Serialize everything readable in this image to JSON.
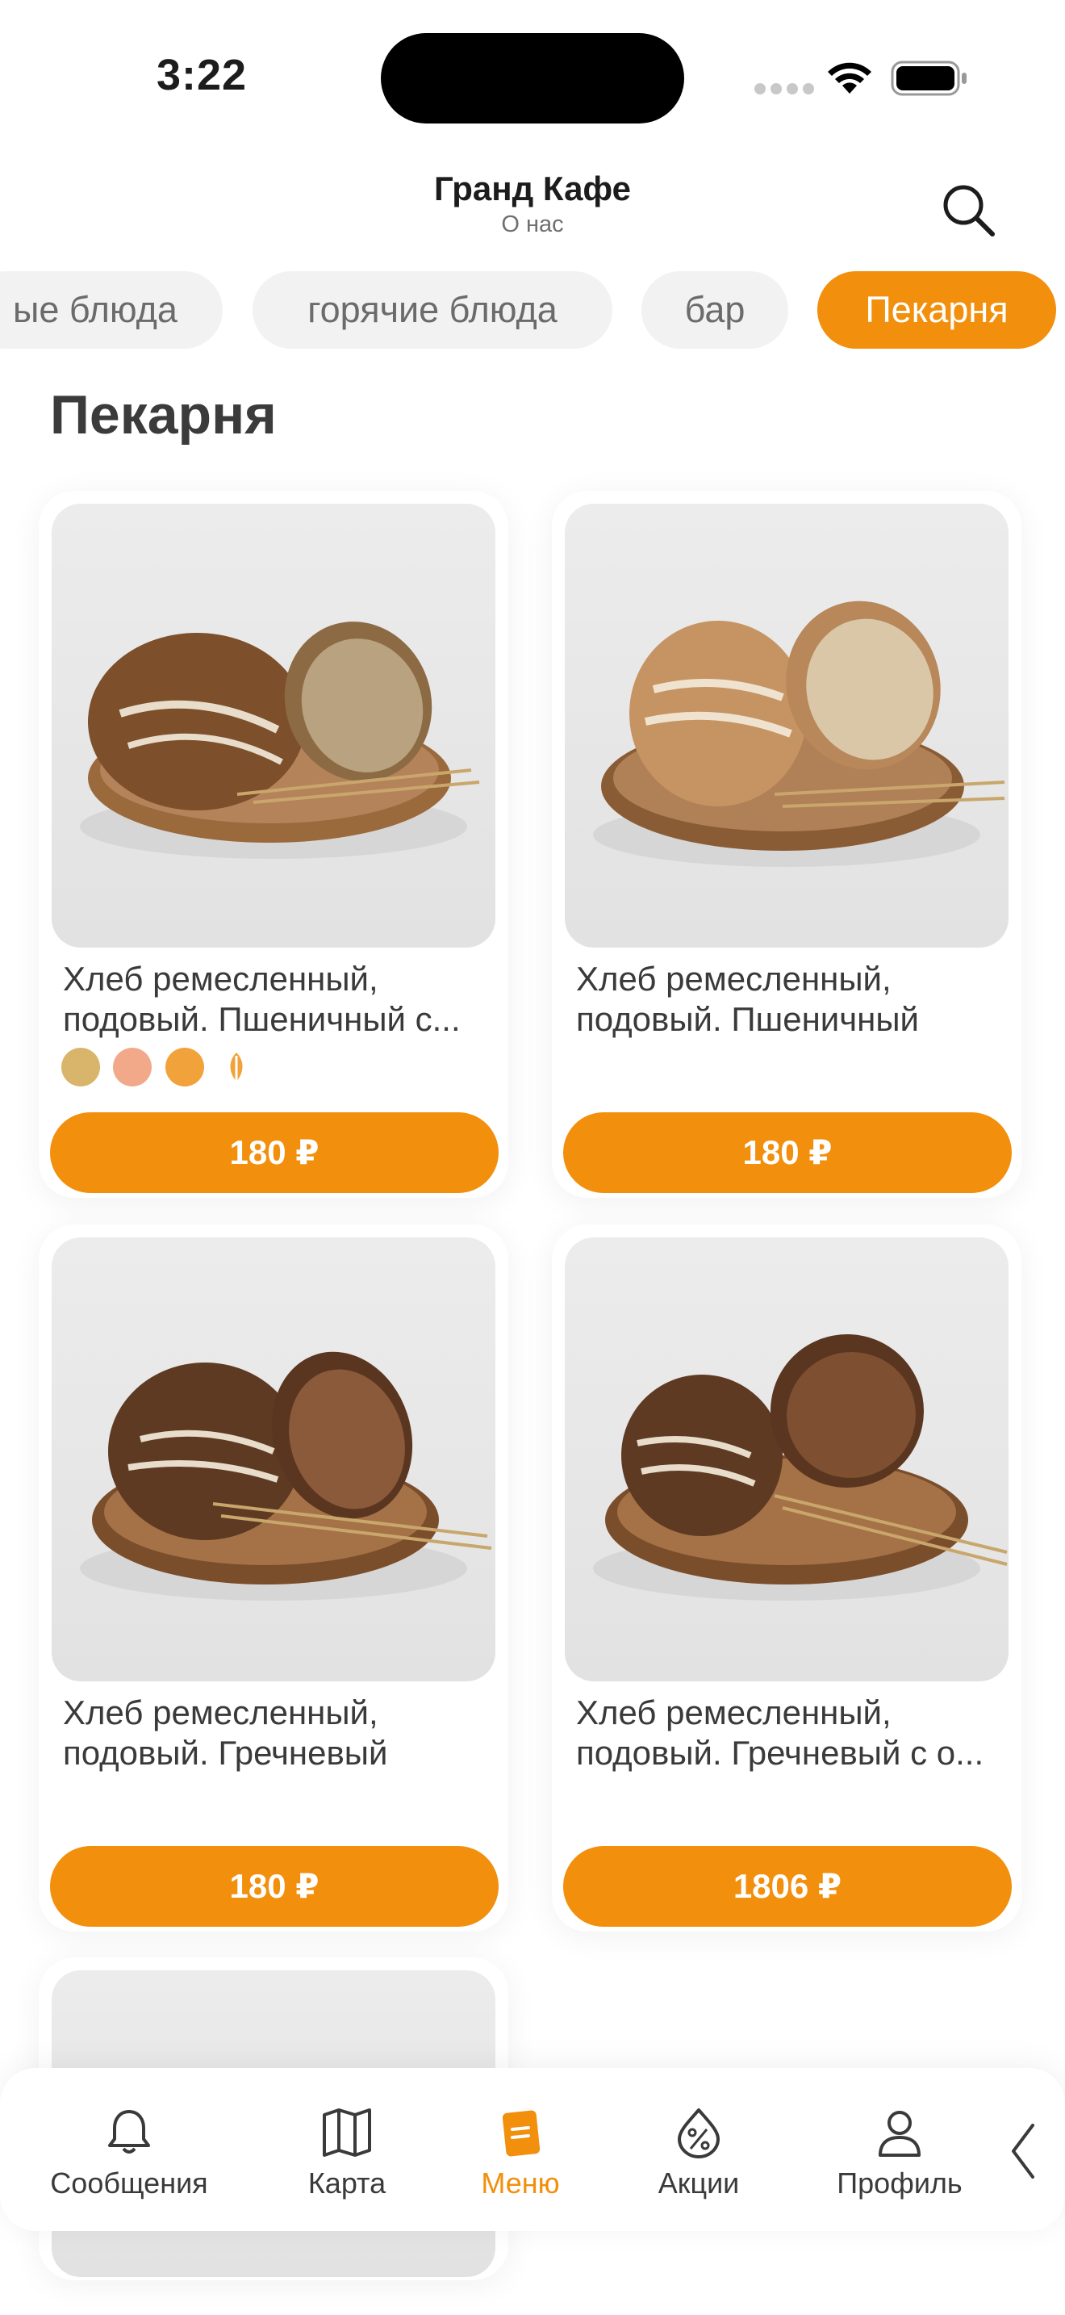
{
  "status": {
    "time": "3:22"
  },
  "header": {
    "title": "Гранд Кафе",
    "subtitle": "О нас",
    "search_icon": "search-icon"
  },
  "tabs": [
    {
      "label": "ые блюда"
    },
    {
      "label": "горячие блюда"
    },
    {
      "label": "бар"
    },
    {
      "label": "Пекарня",
      "active": true
    }
  ],
  "section": {
    "title": "Пекарня"
  },
  "products": [
    {
      "name": "Хлеб ремесленный, подовый. Пшеничный с...",
      "price": "180 ₽",
      "badges": [
        "wheat-icon",
        "egg-icon",
        "honey-icon",
        "grain-icon"
      ]
    },
    {
      "name": "Хлеб ремесленный, подовый. Пшеничный",
      "price": "180 ₽",
      "badges": []
    },
    {
      "name": "Хлеб ремесленный, подовый. Гречневый",
      "price": "180 ₽",
      "badges": []
    },
    {
      "name": "Хлеб ремесленный, подовый. Гречневый с о...",
      "price": "1806 ₽",
      "badges": []
    }
  ],
  "nav": {
    "items": [
      {
        "label": "Сообщения",
        "icon": "bell-icon"
      },
      {
        "label": "Карта",
        "icon": "map-icon"
      },
      {
        "label": "Меню",
        "icon": "menu-icon",
        "active": true
      },
      {
        "label": "Акции",
        "icon": "percent-icon"
      },
      {
        "label": "Профиль",
        "icon": "profile-icon"
      }
    ]
  },
  "colors": {
    "accent": "#f28f0c",
    "tab_bg": "#f2f2f2",
    "text": "#3a3a3a"
  }
}
